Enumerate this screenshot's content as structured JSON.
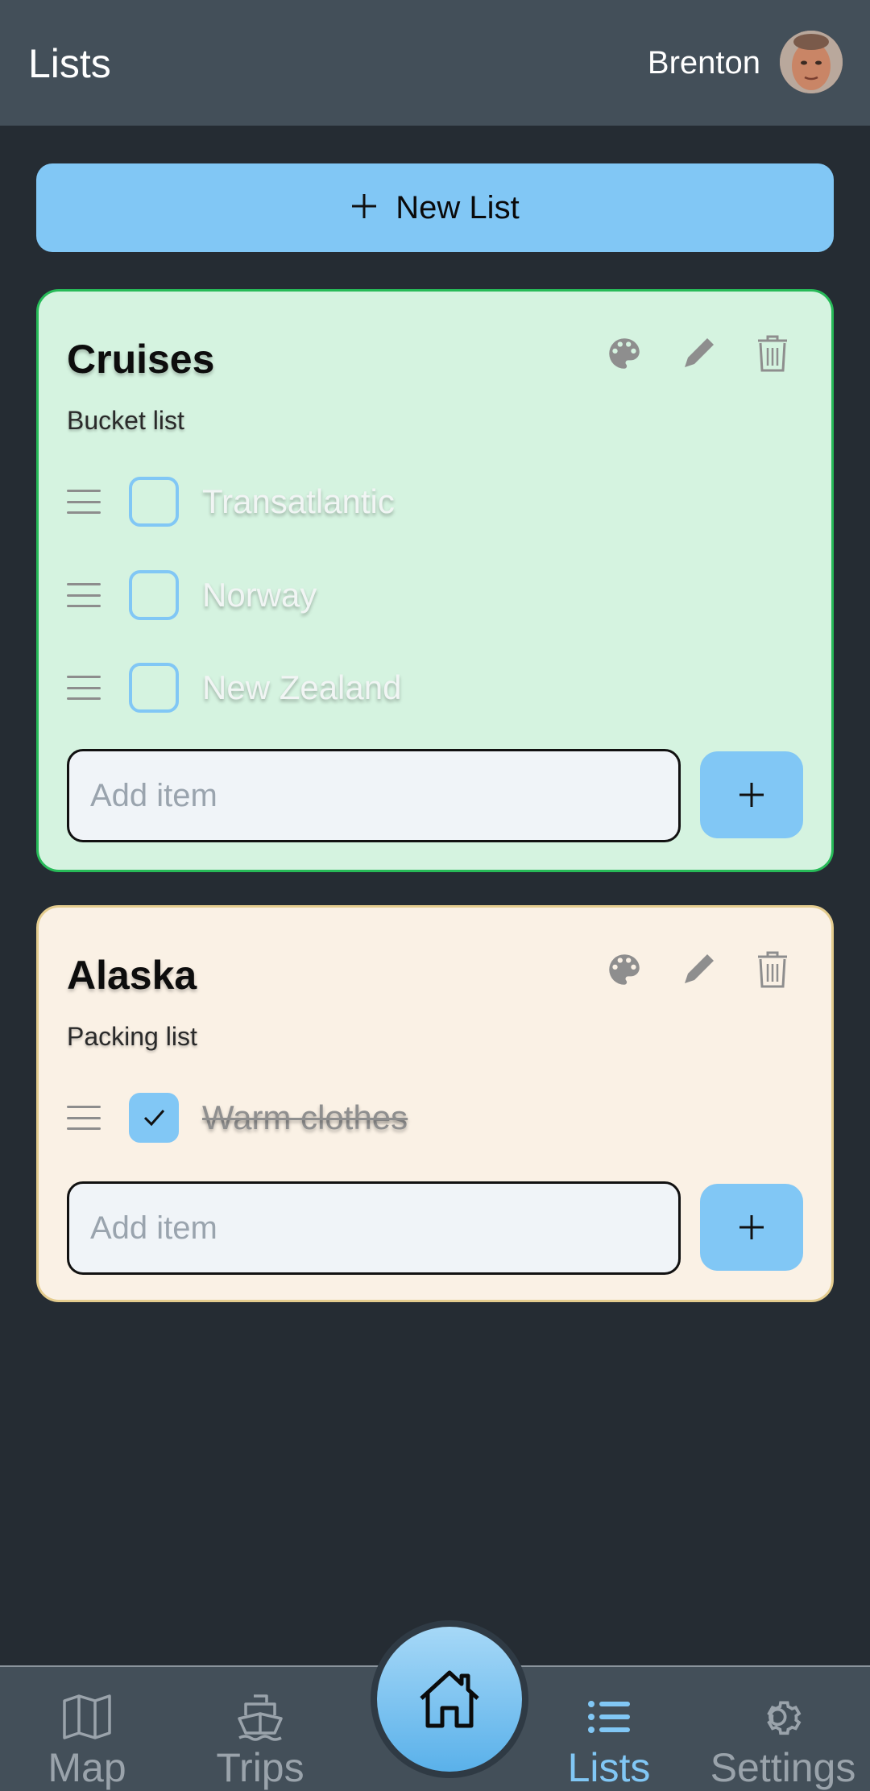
{
  "header": {
    "title": "Lists",
    "user_name": "Brenton"
  },
  "new_list": {
    "label": "New List"
  },
  "lists": [
    {
      "title": "Cruises",
      "subtitle": "Bucket list",
      "color": "#d5f3e0",
      "items": [
        {
          "label": "Transatlantic",
          "checked": false
        },
        {
          "label": "Norway",
          "checked": false
        },
        {
          "label": "New Zealand",
          "checked": false
        }
      ],
      "add_placeholder": "Add item"
    },
    {
      "title": "Alaska",
      "subtitle": "Packing list",
      "color": "#faf1e5",
      "items": [
        {
          "label": "Warm clothes",
          "checked": true
        }
      ],
      "add_placeholder": "Add item"
    }
  ],
  "nav": {
    "items": [
      {
        "label": "Map",
        "icon": "map-icon"
      },
      {
        "label": "Trips",
        "icon": "ship-icon"
      },
      {
        "label": "Home",
        "icon": "home-icon"
      },
      {
        "label": "Lists",
        "icon": "list-icon",
        "active": true
      },
      {
        "label": "Settings",
        "icon": "gear-icon"
      }
    ]
  },
  "colors": {
    "accent": "#81c7f5",
    "background": "#252c33",
    "bar": "#434f59"
  }
}
